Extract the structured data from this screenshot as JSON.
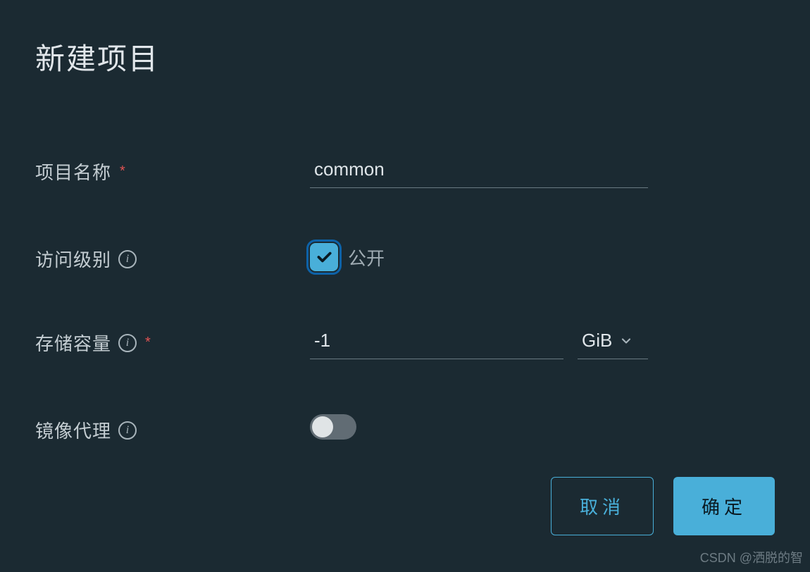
{
  "dialog": {
    "title": "新建项目"
  },
  "fields": {
    "project_name": {
      "label": "项目名称",
      "value": "common",
      "required": true
    },
    "access_level": {
      "label": "访问级别",
      "checkbox_label": "公开",
      "checked": true
    },
    "storage": {
      "label": "存储容量",
      "value": "-1",
      "unit": "GiB",
      "required": true
    },
    "image_proxy": {
      "label": "镜像代理",
      "enabled": false
    }
  },
  "buttons": {
    "cancel": "取消",
    "confirm": "确定"
  },
  "watermark": "CSDN @洒脱的智"
}
